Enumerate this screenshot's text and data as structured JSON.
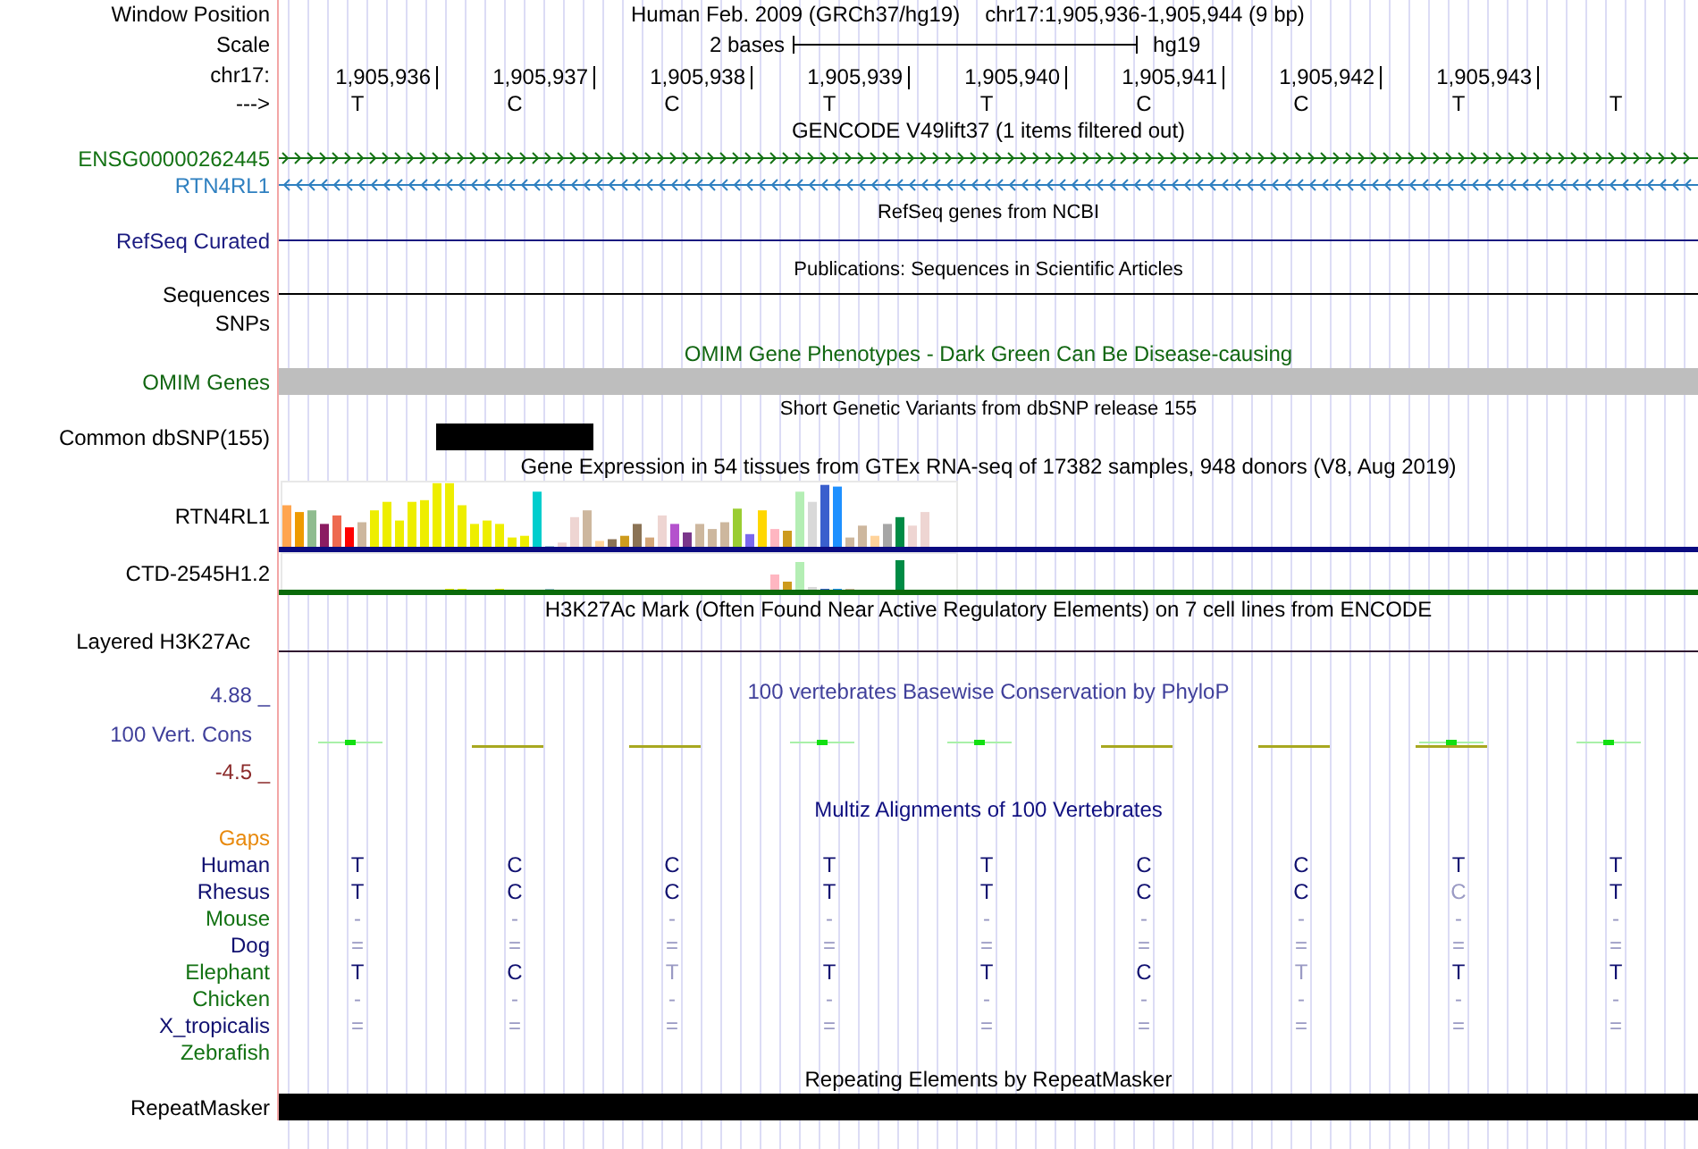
{
  "window_position": {
    "label": "Window Position",
    "assembly": "Human Feb. 2009 (GRCh37/hg19)",
    "region": "chr17:1,905,936-1,905,944 (9 bp)"
  },
  "scale": {
    "label": "Scale",
    "span": "2 bases",
    "assembly": "hg19"
  },
  "ruler": {
    "label": "chr17:",
    "positions": [
      "1,905,936",
      "1,905,937",
      "1,905,938",
      "1,905,939",
      "1,905,940",
      "1,905,941",
      "1,905,942",
      "1,905,943"
    ]
  },
  "sequence": {
    "label": "--->",
    "bases": [
      "T",
      "C",
      "C",
      "T",
      "T",
      "C",
      "C",
      "T",
      "T"
    ]
  },
  "tracks": [
    {
      "kind": "title",
      "text": "GENCODE V49lift37 (1 items filtered out)",
      "small": false,
      "color": "#000000"
    },
    {
      "kind": "gene",
      "label": "ENSG00000262445",
      "color": "#137213",
      "reverse": false
    },
    {
      "kind": "gene",
      "label": "RTN4RL1",
      "color": "#2f80c0",
      "reverse": true
    },
    {
      "kind": "title",
      "text": "RefSeq genes from NCBI",
      "small": true,
      "color": "#000000"
    },
    {
      "kind": "line",
      "label": "RefSeq Curated",
      "color": "#1a1a80"
    },
    {
      "kind": "title",
      "text": "Publications: Sequences in Scientific Articles",
      "small": true,
      "color": "#000000"
    },
    {
      "kind": "line",
      "label": "Sequences",
      "color": "#000000"
    },
    {
      "kind": "empty",
      "label": "SNPs",
      "color": "#000000"
    },
    {
      "kind": "title",
      "text": "OMIM Gene Phenotypes - Dark Green Can Be Disease-causing",
      "small": false,
      "color": "#116611"
    },
    {
      "kind": "omim",
      "label": "OMIM Genes",
      "color": "#116611"
    },
    {
      "kind": "title",
      "text": "Short Genetic Variants from dbSNP release 155",
      "small": true,
      "color": "#000000"
    },
    {
      "kind": "snp",
      "label": "Common dbSNP(155)",
      "color": "#000000",
      "covered": [
        false,
        true,
        false,
        false,
        false,
        false,
        false,
        false,
        false
      ]
    },
    {
      "kind": "title",
      "text": "Gene Expression in 54 tissues from GTEx RNA-seq of 17382 samples, 948 donors (V8, Aug 2019)",
      "small": false,
      "color": "#000000"
    },
    {
      "kind": "expression",
      "label": "RTN4RL1",
      "color": "#0a0a80"
    },
    {
      "kind": "expression",
      "label": "CTD-2545H1.2",
      "color": "#0a6a0a"
    },
    {
      "kind": "title",
      "text": "H3K27Ac Mark (Often Found Near Active Regulatory Elements) on 7 cell lines from ENCODE",
      "small": false,
      "color": "#000000"
    },
    {
      "kind": "layered",
      "label": "Layered H3K27Ac",
      "color": "#000000"
    },
    {
      "kind": "conservation",
      "title": "100 vertebrates Basewise Conservation by PhyloP",
      "label": "100 Vert. Cons",
      "max": "4.88 _",
      "min": "-4.5 _",
      "color": "#3f3f9a"
    },
    {
      "kind": "title",
      "text": "Multiz Alignments of 100 Vertebrates",
      "small": false,
      "color": "#101080"
    },
    {
      "kind": "empty",
      "label": "Gaps",
      "color": "#e8890c"
    },
    {
      "kind": "species",
      "label": "Human",
      "color": "#101070",
      "bases": [
        {
          "text": "T",
          "dim": false
        },
        {
          "text": "C",
          "dim": false
        },
        {
          "text": "C",
          "dim": false
        },
        {
          "text": "T",
          "dim": false
        },
        {
          "text": "T",
          "dim": false
        },
        {
          "text": "C",
          "dim": false
        },
        {
          "text": "C",
          "dim": false
        },
        {
          "text": "T",
          "dim": false
        },
        {
          "text": "T",
          "dim": false
        }
      ]
    },
    {
      "kind": "species",
      "label": "Rhesus",
      "color": "#101070",
      "bases": [
        {
          "text": "T",
          "dim": false
        },
        {
          "text": "C",
          "dim": false
        },
        {
          "text": "C",
          "dim": false
        },
        {
          "text": "T",
          "dim": false
        },
        {
          "text": "T",
          "dim": false
        },
        {
          "text": "C",
          "dim": false
        },
        {
          "text": "C",
          "dim": false
        },
        {
          "text": "C",
          "dim": true
        },
        {
          "text": "T",
          "dim": false
        }
      ]
    },
    {
      "kind": "species",
      "label": "Mouse",
      "color": "#137213",
      "bases": [
        {
          "text": "-",
          "dim": true
        },
        {
          "text": "-",
          "dim": true
        },
        {
          "text": "-",
          "dim": true
        },
        {
          "text": "-",
          "dim": true
        },
        {
          "text": "-",
          "dim": true
        },
        {
          "text": "-",
          "dim": true
        },
        {
          "text": "-",
          "dim": true
        },
        {
          "text": "-",
          "dim": true
        },
        {
          "text": "-",
          "dim": true
        }
      ]
    },
    {
      "kind": "species",
      "label": "Dog",
      "color": "#101070",
      "bases": [
        {
          "text": "=",
          "dim": true
        },
        {
          "text": "=",
          "dim": true
        },
        {
          "text": "=",
          "dim": true
        },
        {
          "text": "=",
          "dim": true
        },
        {
          "text": "=",
          "dim": true
        },
        {
          "text": "=",
          "dim": true
        },
        {
          "text": "=",
          "dim": true
        },
        {
          "text": "=",
          "dim": true
        },
        {
          "text": "=",
          "dim": true
        }
      ]
    },
    {
      "kind": "species",
      "label": "Elephant",
      "color": "#137213",
      "bases": [
        {
          "text": "T",
          "dim": false
        },
        {
          "text": "C",
          "dim": false
        },
        {
          "text": "T",
          "dim": true
        },
        {
          "text": "T",
          "dim": false
        },
        {
          "text": "T",
          "dim": false
        },
        {
          "text": "C",
          "dim": false
        },
        {
          "text": "T",
          "dim": true
        },
        {
          "text": "T",
          "dim": false
        },
        {
          "text": "T",
          "dim": false
        }
      ]
    },
    {
      "kind": "species",
      "label": "Chicken",
      "color": "#137213",
      "bases": [
        {
          "text": "-",
          "dim": true
        },
        {
          "text": "-",
          "dim": true
        },
        {
          "text": "-",
          "dim": true
        },
        {
          "text": "-",
          "dim": true
        },
        {
          "text": "-",
          "dim": true
        },
        {
          "text": "-",
          "dim": true
        },
        {
          "text": "-",
          "dim": true
        },
        {
          "text": "-",
          "dim": true
        },
        {
          "text": "-",
          "dim": true
        }
      ]
    },
    {
      "kind": "species",
      "label": "X_tropicalis",
      "color": "#101070",
      "bases": [
        {
          "text": "=",
          "dim": true
        },
        {
          "text": "=",
          "dim": true
        },
        {
          "text": "=",
          "dim": true
        },
        {
          "text": "=",
          "dim": true
        },
        {
          "text": "=",
          "dim": true
        },
        {
          "text": "=",
          "dim": true
        },
        {
          "text": "=",
          "dim": true
        },
        {
          "text": "=",
          "dim": true
        },
        {
          "text": "=",
          "dim": true
        }
      ]
    },
    {
      "kind": "empty",
      "label": "Zebrafish",
      "color": "#137213"
    },
    {
      "kind": "title",
      "text": "Repeating Elements by RepeatMasker",
      "small": false,
      "color": "#000000"
    },
    {
      "kind": "repeat",
      "label": "RepeatMasker",
      "color": "#000000"
    }
  ]
}
